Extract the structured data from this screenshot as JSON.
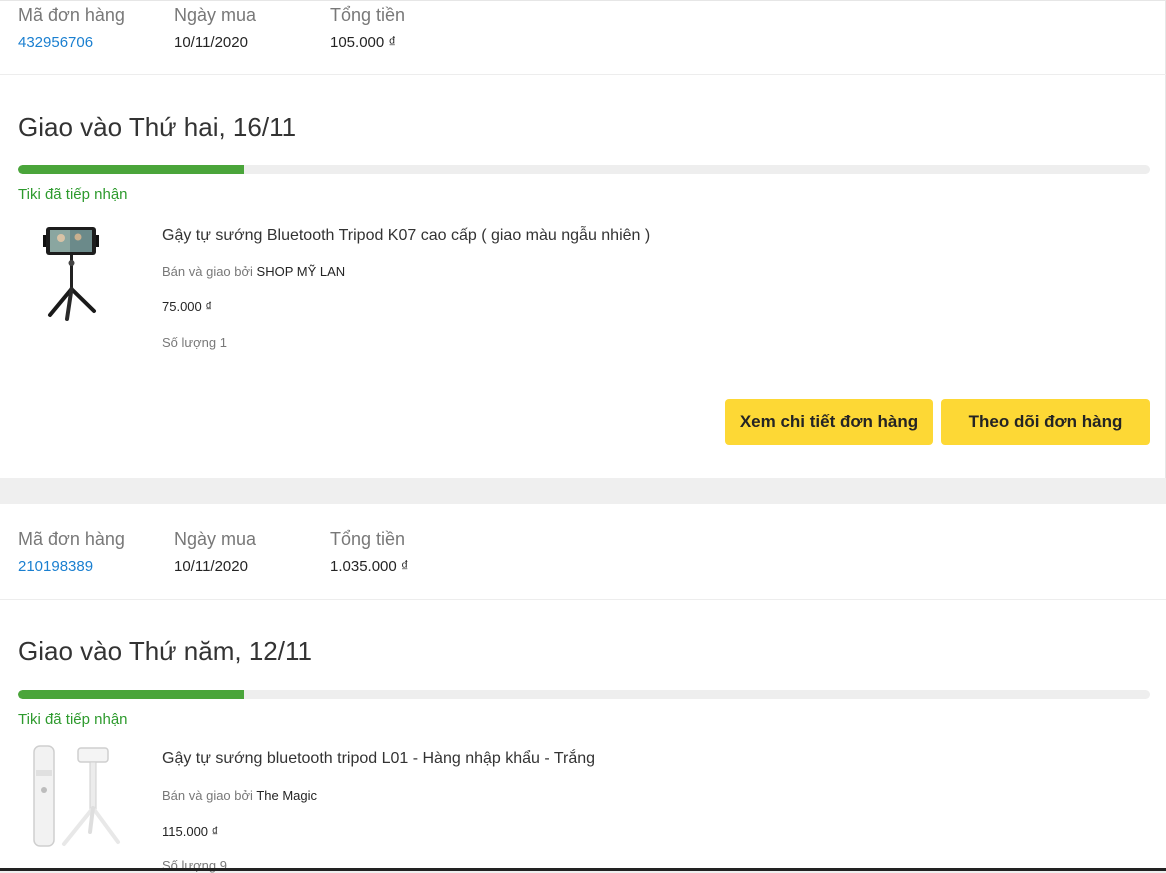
{
  "labels": {
    "order_id": "Mã đơn hàng",
    "purchase_date": "Ngày mua",
    "total": "Tổng tiền",
    "seller_prefix": "Bán và giao bởi",
    "qty_prefix": "Số lượng"
  },
  "orders": [
    {
      "order_id": "432956706",
      "date": "10/11/2020",
      "total": "105.000 ₫",
      "delivery": "Giao vào Thứ hai, 16/11",
      "progress_percent": 20,
      "status": "Tiki đã tiếp nhận",
      "item": {
        "name": "Gậy tự sướng Bluetooth Tripod K07 cao cấp ( giao màu ngẫu nhiên )",
        "seller": "SHOP MỸ LAN",
        "price": "75.000 ₫",
        "quantity": "1"
      },
      "buttons": {
        "detail": "Xem chi tiết đơn hàng",
        "track": "Theo dõi đơn hàng"
      }
    },
    {
      "order_id": "210198389",
      "date": "10/11/2020",
      "total": "1.035.000 ₫",
      "delivery": "Giao vào Thứ năm, 12/11",
      "progress_percent": 20,
      "status": "Tiki đã tiếp nhận",
      "item": {
        "name": "Gậy tự sướng bluetooth tripod L01 - Hàng nhập khẩu - Trắng",
        "seller": "The Magic",
        "price": "115.000 ₫",
        "quantity": "9"
      }
    }
  ],
  "colors": {
    "accent_button": "#fdd835",
    "progress": "#4aa53a",
    "link": "#1a7fd0",
    "status": "#2d9a2d"
  }
}
